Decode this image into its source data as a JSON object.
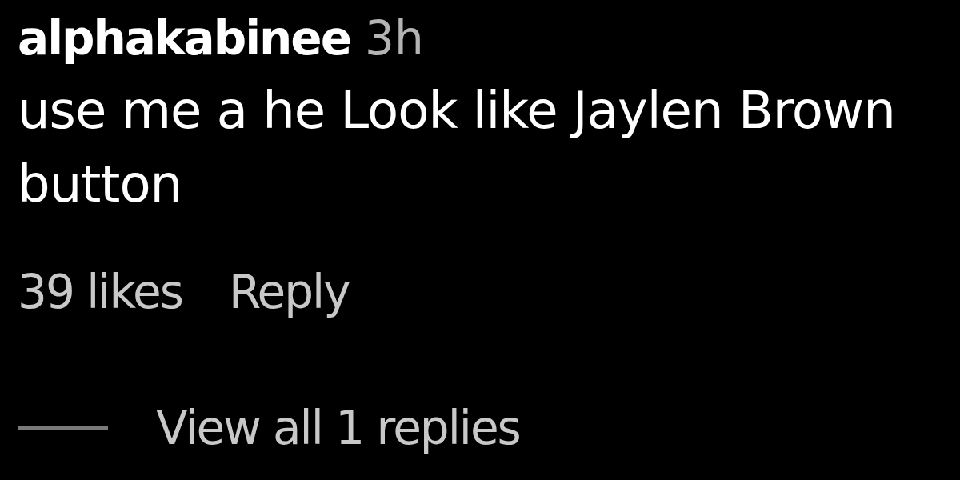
{
  "comment": {
    "username": "alphakabinee",
    "time": "3h",
    "text": "use me a he Look like Jaylen Brown button",
    "likes": "39 likes",
    "reply_link": "Reply"
  },
  "replies_toggle": {
    "label": "View all 1 replies"
  }
}
